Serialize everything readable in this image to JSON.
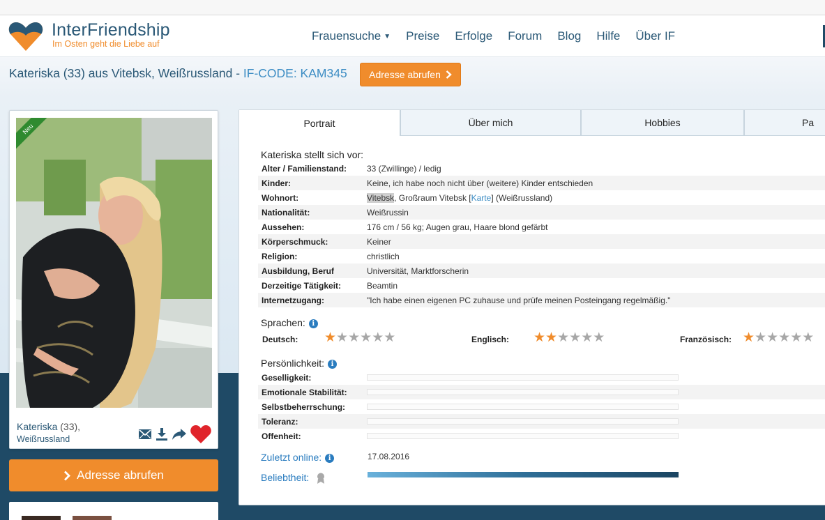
{
  "header": {
    "brand": "InterFriendship",
    "tagline": "Im Osten geht die Liebe auf",
    "nav": [
      {
        "label": "Frauensuche",
        "dropdown": true
      },
      {
        "label": "Preise"
      },
      {
        "label": "Erfolge"
      },
      {
        "label": "Forum"
      },
      {
        "label": "Blog"
      },
      {
        "label": "Hilfe"
      },
      {
        "label": "Über IF"
      }
    ]
  },
  "title": {
    "name": "Kateriska (33) aus Vitebsk, Weißrussland",
    "separator": " - ",
    "code": "IF-CODE: KAM345",
    "button": "Adresse abrufen"
  },
  "card": {
    "badge": "Neu",
    "name": "Kateriska",
    "age": " (33),",
    "country": "Weißrussland",
    "icons": [
      "envelope-icon",
      "download-icon",
      "share-icon",
      "heart-icon"
    ],
    "button": "Adresse abrufen"
  },
  "tabs": [
    "Portrait",
    "Über mich",
    "Hobbies",
    "Pa"
  ],
  "portrait": {
    "heading": "Kateriska stellt sich vor:",
    "rows": [
      {
        "label": "Alter / Familienstand:",
        "value": "33 (Zwillinge) / ledig"
      },
      {
        "label": "Kinder:",
        "value": "Keine, ich habe noch nicht über (weitere) Kinder entschieden"
      },
      {
        "label": "Wohnort:",
        "value_highlight": "Vitebsk",
        "value_pre": ", Großraum Vitebsk [",
        "value_link": "Karte",
        "value_post": "] (Weißrussland)"
      },
      {
        "label": "Nationalität:",
        "value": "Weißrussin"
      },
      {
        "label": "Aussehen:",
        "value": "176 cm / 56 kg; Augen grau, Haare blond gefärbt"
      },
      {
        "label": "Körperschmuck:",
        "value": "Keiner"
      },
      {
        "label": "Religion:",
        "value": "christlich"
      },
      {
        "label": "Ausbildung, Beruf",
        "value": "Universität, Marktforscherin"
      },
      {
        "label": "Derzeitige Tätigkeit:",
        "value": "Beamtin"
      },
      {
        "label": "Internetzugang:",
        "value": "\"Ich habe einen eigenen PC zuhause und prüfe meinen Posteingang regelmäßig.\""
      }
    ]
  },
  "languages": {
    "heading": "Sprachen:",
    "items": [
      {
        "label": "Deutsch:",
        "stars": 1,
        "max": 6
      },
      {
        "label": "Englisch:",
        "stars": 2,
        "max": 6
      },
      {
        "label": "Französisch:",
        "stars": 1,
        "max": 6
      }
    ]
  },
  "personality": {
    "heading": "Persönlichkeit:",
    "items": [
      {
        "label": "Geselligkeit:"
      },
      {
        "label": "Emotionale Stabilität:"
      },
      {
        "label": "Selbstbeherrschung:"
      },
      {
        "label": "Toleranz:"
      },
      {
        "label": "Offenheit:"
      }
    ]
  },
  "online": {
    "label": "Zuletzt online:",
    "date": "17.08.2016"
  },
  "popularity": {
    "label": "Beliebtheit:",
    "level": 1.0
  },
  "colors": {
    "brand_blue": "#2a5876",
    "accent_orange": "#f08c2c",
    "link_blue": "#2a7cbf"
  }
}
